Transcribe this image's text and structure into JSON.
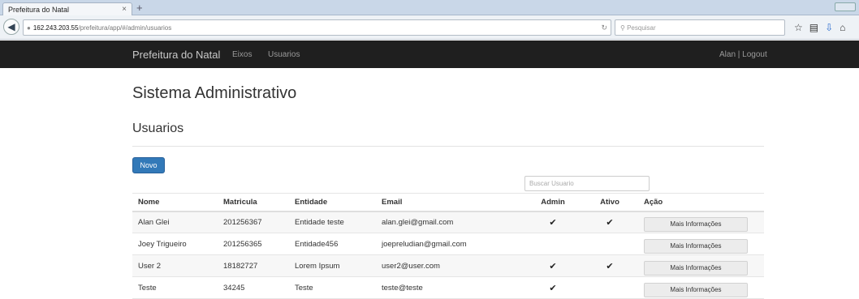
{
  "browser": {
    "tab_title": "Prefeitura do Natal",
    "tab_close": "×",
    "new_tab": "+",
    "url_host": "162.243.203.55",
    "url_path": "/prefeitura/app/#/admin/usuarios",
    "search_placeholder": "Pesquisar",
    "icons": [
      "back-icon",
      "lock-icon",
      "reload-icon",
      "search-icon",
      "star-icon",
      "bookmarks-icon",
      "download-icon",
      "home-icon"
    ]
  },
  "site_nav": {
    "brand": "Prefeitura do Natal",
    "links": [
      "Eixos",
      "Usuarios"
    ],
    "user": "Alan | Logout"
  },
  "page": {
    "title": "Sistema Administrativo",
    "section": "Usuarios",
    "new_button": "Novo",
    "search_placeholder": "Buscar Usuario"
  },
  "table": {
    "headers": [
      "Nome",
      "Matricula",
      "Entidade",
      "Email",
      "Admin",
      "Ativo",
      "Ação"
    ],
    "rows": [
      {
        "nome": "Alan Glei",
        "matricula": "201256367",
        "entidade": "Entidade teste",
        "email": "alan.glei@gmail.com",
        "admin": "✔",
        "ativo": "✔",
        "acao": "Mais Informações"
      },
      {
        "nome": "Joey Trigueiro",
        "matricula": "201256365",
        "entidade": "Entidade456",
        "email": "joepreludian@gmail.com",
        "admin": "",
        "ativo": "",
        "acao": "Mais Informações"
      },
      {
        "nome": "User 2",
        "matricula": "18182727",
        "entidade": "Lorem Ipsum",
        "email": "user2@user.com",
        "admin": "✔",
        "ativo": "✔",
        "acao": "Mais Informações"
      },
      {
        "nome": "Teste",
        "matricula": "34245",
        "entidade": "Teste",
        "email": "teste@teste",
        "admin": "✔",
        "ativo": "",
        "acao": "Mais Informações"
      }
    ]
  },
  "colors": {
    "navbar": "#1f1f1f",
    "primary_button": "#3279b8"
  }
}
